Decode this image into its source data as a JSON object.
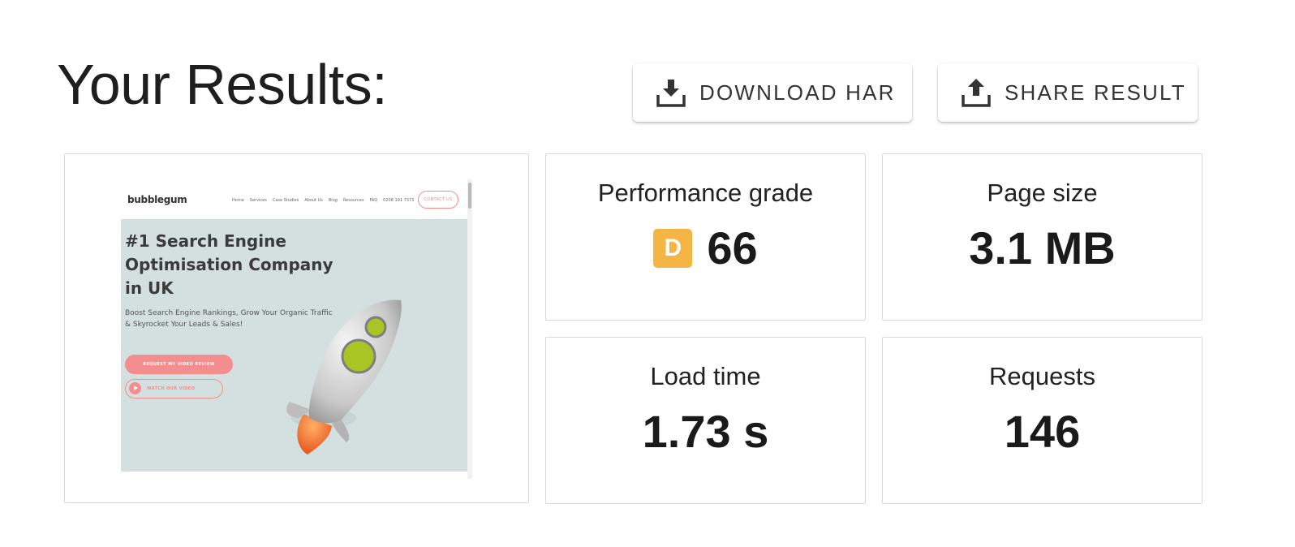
{
  "header": {
    "title": "Your Results:"
  },
  "actions": {
    "download_label": "DOWNLOAD HAR",
    "share_label": "SHARE RESULT"
  },
  "metrics": {
    "performance": {
      "label": "Performance grade",
      "grade": "D",
      "score": "66",
      "grade_color": "#f5b544"
    },
    "page_size": {
      "label": "Page size",
      "value": "3.1 MB"
    },
    "load_time": {
      "label": "Load time",
      "value": "1.73 s"
    },
    "requests": {
      "label": "Requests",
      "value": "146"
    }
  },
  "thumbnail": {
    "logo": "bubblegum",
    "nav_links": [
      "Home",
      "Services",
      "Case Studies",
      "About Us",
      "Blog",
      "Resources",
      "FAQ",
      "0208 191 7373"
    ],
    "contact_label": "CONTACT US",
    "heading": "#1 Search Engine Optimisation Company in UK",
    "subheading": "Boost Search Engine Rankings, Grow Your Organic Traffic & Skyrocket Your Leads & Sales!",
    "cta_label": "REQUEST MY VIDEO REVIEW",
    "watch_label": "WATCH OUR VIDEO",
    "hero_color": "#d3e0df",
    "accent_color": "#f48d8d"
  }
}
